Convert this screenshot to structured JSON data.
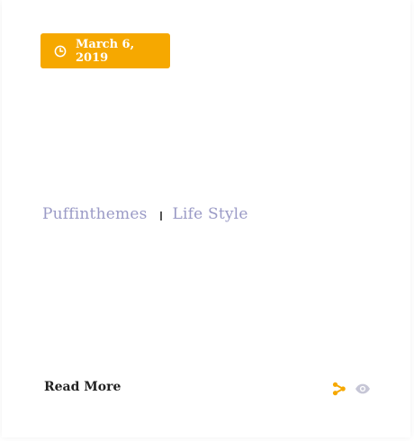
{
  "post": {
    "date": "March 6, 2019",
    "author": "Puffinthemes",
    "category": "Life Style",
    "read_more_label": "Read More"
  },
  "icons": {
    "date": "clock-icon",
    "share": "share-icon",
    "views": "eye-icon"
  },
  "colors": {
    "accent": "#F6A800",
    "meta_text": "#9A9AC6",
    "icon_muted": "#C6C6D6",
    "read_more_text": "#222222"
  }
}
